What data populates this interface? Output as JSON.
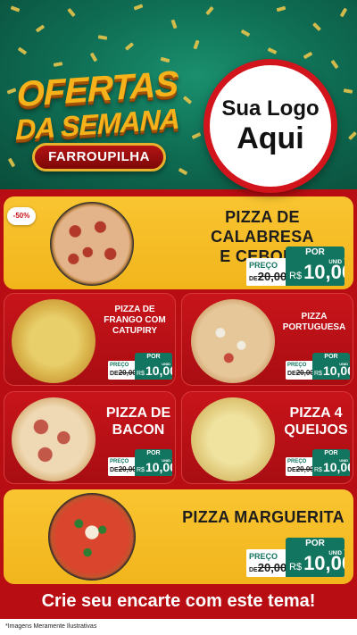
{
  "header": {
    "title_line1": "OFERTAS",
    "title_line2": "DA SEMANA",
    "city": "FARROUPILHA",
    "logo_line1": "Sua Logo",
    "logo_line2": "Aqui"
  },
  "colors": {
    "header_green": "#0f6f55",
    "title_gold": "#f5b21a",
    "card_yellow": "#f2b51c",
    "card_red": "#b80d12",
    "price_green": "#12755f"
  },
  "products": [
    {
      "name_line1": "PIZZA DE CALABRESA",
      "name_line2": "E CEBOLA",
      "discount_badge": "-50%",
      "price_label": "PREÇO",
      "old_prefix": "DE",
      "old_price": "20,00",
      "new_label": "POR",
      "currency": "R$",
      "new_price": "10,00",
      "unit": "UNID"
    },
    {
      "name": "PIZZA DE FRANGO COM CATUPIRY",
      "price_label": "PREÇO",
      "old_prefix": "DE",
      "old_price": "20,00",
      "new_label": "POR",
      "currency": "R$",
      "new_price": "10,00",
      "unit": "UNID"
    },
    {
      "name": "PIZZA PORTUGUESA",
      "price_label": "PREÇO",
      "old_prefix": "DE",
      "old_price": "20,00",
      "new_label": "POR",
      "currency": "R$",
      "new_price": "10,00",
      "unit": "UNID"
    },
    {
      "name": "PIZZA DE BACON",
      "price_label": "PREÇO",
      "old_prefix": "DE",
      "old_price": "20,00",
      "new_label": "POR",
      "currency": "R$",
      "new_price": "10,00",
      "unit": "UNID"
    },
    {
      "name": "PIZZA 4 QUEIJOS",
      "price_label": "PREÇO",
      "old_prefix": "DE",
      "old_price": "20,00",
      "new_label": "POR",
      "currency": "R$",
      "new_price": "10,00",
      "unit": "UNID"
    },
    {
      "name": "PIZZA MARGUERITA",
      "price_label": "PREÇO",
      "old_prefix": "DE",
      "old_price": "20,00",
      "new_label": "POR",
      "currency": "R$",
      "new_price": "10,00",
      "unit": "UNID"
    }
  ],
  "cta": "Crie seu encarte com este tema!",
  "footer": "*Imagens Meramente Ilustrativas"
}
